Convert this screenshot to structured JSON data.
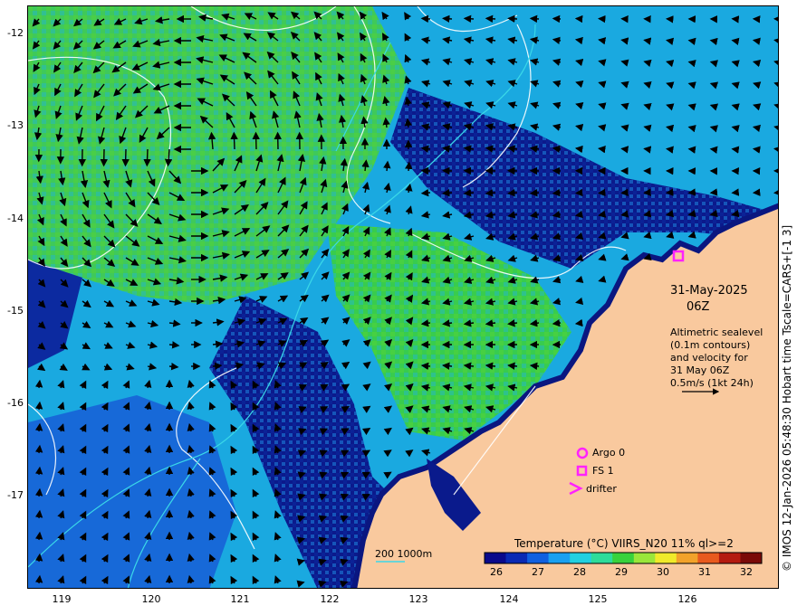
{
  "map": {
    "date": "31-May-2025",
    "time": "06Z",
    "altimetry_lines": [
      "Altimetric sealevel",
      "(0.1m contours)",
      "and velocity for",
      "31 May 06Z",
      "0.5m/s (1kt 24h)"
    ],
    "legend": {
      "argo_label": "Argo 0",
      "fs_label": "FS 1",
      "drifter_label": "drifter"
    },
    "depth_label": "200  1000m",
    "colorbar": {
      "title": "Temperature (°C) VIIRS_N20 11% ql>=2",
      "ticks": [
        "26",
        "27",
        "28",
        "29",
        "30",
        "31",
        "32"
      ]
    },
    "credit": "© IMOS 12-Jan-2026 05:48:30 Hobart time Tscale=CARS+[-1 3]",
    "lat_ticks": [
      "-12",
      "-13",
      "-14",
      "-15",
      "-16",
      "-17"
    ],
    "lon_ticks": [
      "119",
      "120",
      "121",
      "122",
      "123",
      "124",
      "125",
      "126"
    ],
    "colors": {
      "land": "#f9c99e",
      "cold": "#0a1a8c",
      "cool": "#1c6ee0",
      "mid": "#1ec8d8",
      "warm": "#2ed23c",
      "contour": "#ffffff",
      "isobath": "#3ad8e8",
      "marker": "#ff22ff"
    }
  }
}
